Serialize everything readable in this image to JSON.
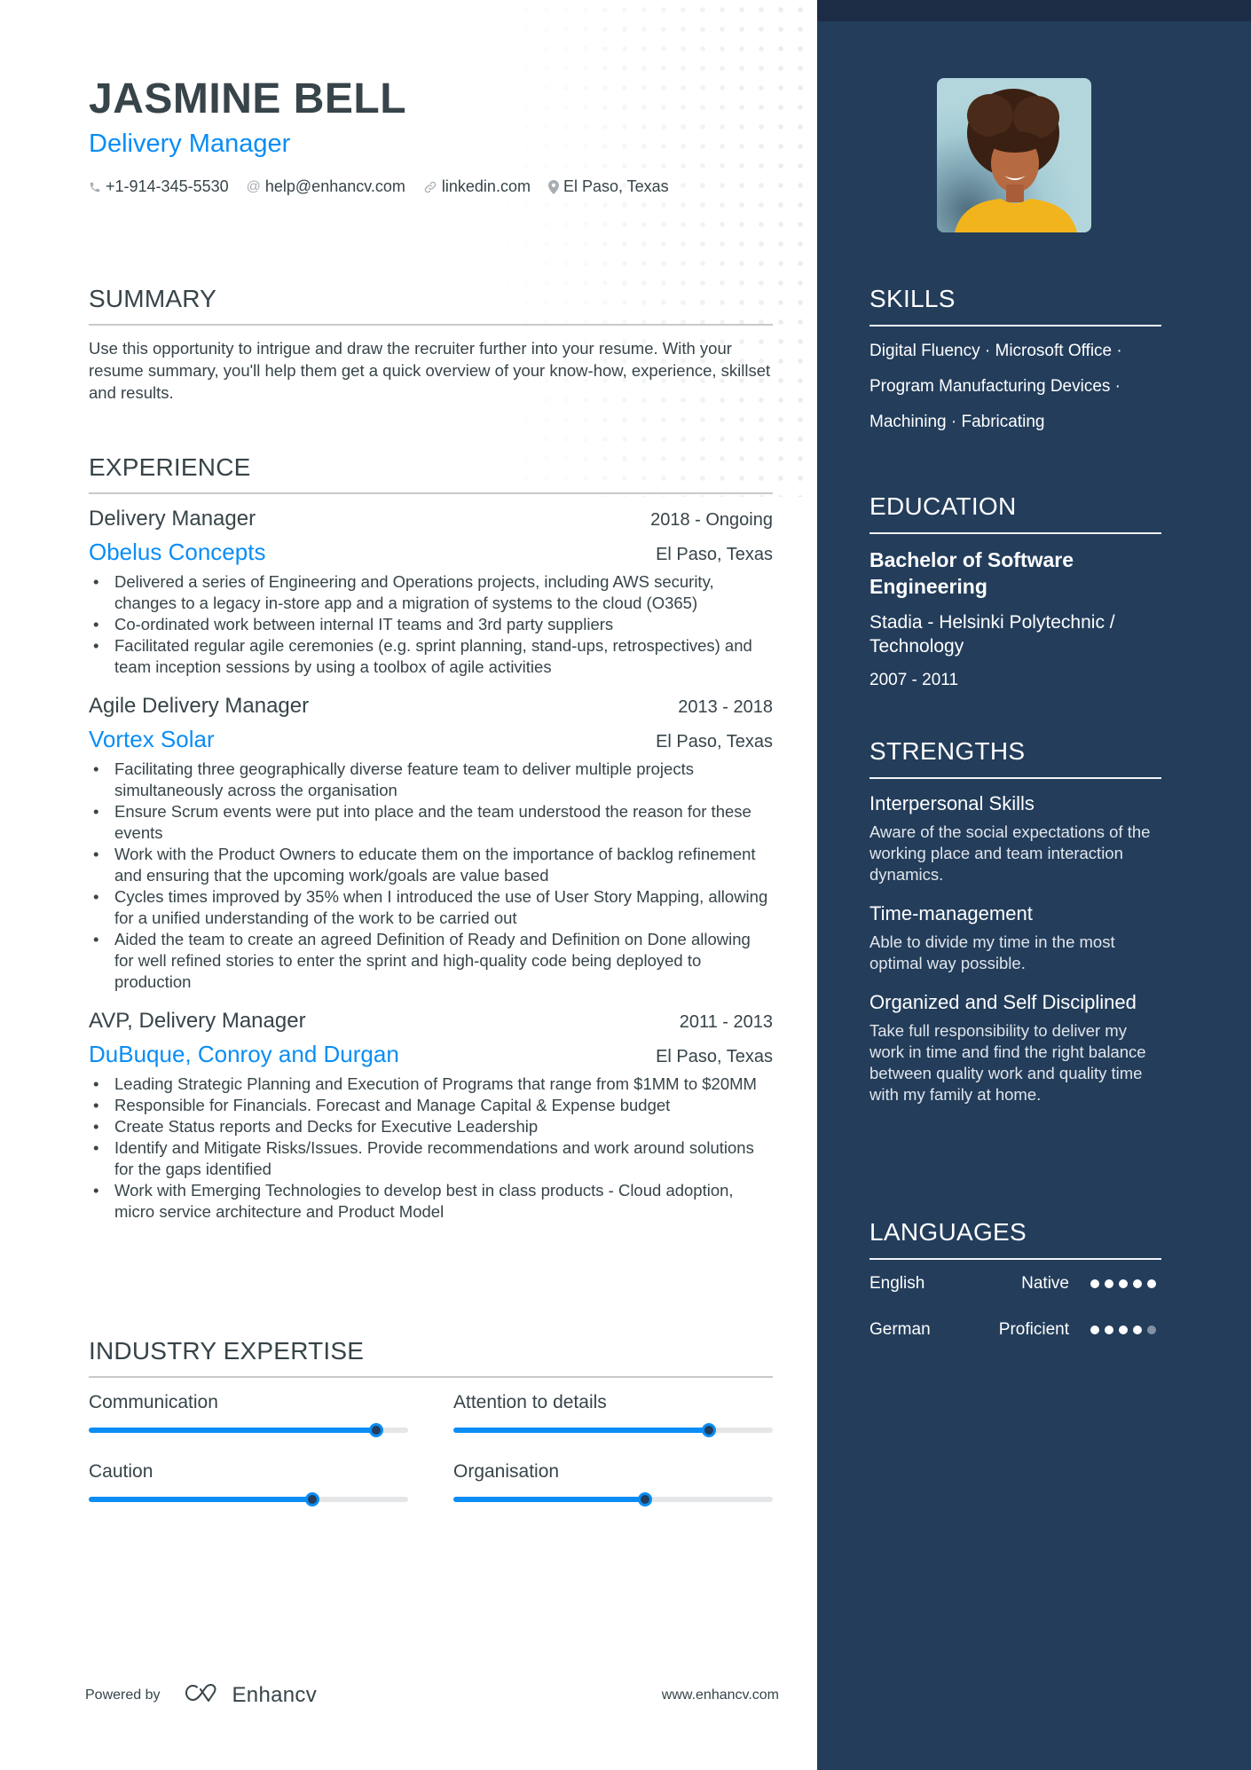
{
  "colors": {
    "accent": "#0a8df5",
    "text": "#374449",
    "sidebar_bg": "#233d5b",
    "sidebar_top": "#1b2c44",
    "slider_track": "#e5e6e7"
  },
  "header": {
    "name": "JASMINE BELL",
    "title": "Delivery Manager",
    "contacts": [
      {
        "icon": "phone-icon",
        "text": "+1-914-345-5530"
      },
      {
        "icon": "at-icon",
        "text": "help@enhancv.com"
      },
      {
        "icon": "link-icon",
        "text": "linkedin.com"
      },
      {
        "icon": "location-pin-icon",
        "text": "El Paso, Texas"
      }
    ]
  },
  "summary": {
    "title": "SUMMARY",
    "text": "Use this opportunity to intrigue and draw the recruiter further into your resume. With your resume summary, you'll help them get a quick overview of your know-how, experience, skillset and results."
  },
  "experience": {
    "title": "EXPERIENCE",
    "jobs": [
      {
        "role": "Delivery Manager",
        "dates": "2018 - Ongoing",
        "company": "Obelus Concepts",
        "location": "El Paso, Texas",
        "bullets": [
          "Delivered a series of Engineering and Operations projects, including AWS security, changes to a legacy in-store app and a migration of systems to the cloud (O365)",
          "Co-ordinated work between internal IT teams and 3rd party suppliers",
          "Facilitated regular agile ceremonies (e.g. sprint planning, stand-ups, retrospectives) and team inception sessions by using a toolbox of agile activities"
        ]
      },
      {
        "role": "Agile Delivery Manager",
        "dates": "2013 - 2018",
        "company": "Vortex Solar",
        "location": "El Paso, Texas",
        "bullets": [
          "Facilitating three geographically diverse feature team to deliver multiple projects simultaneously across the organisation",
          "Ensure Scrum events were put into place and the team understood the reason for these events",
          "Work with the Product Owners to educate them on the importance of backlog refinement and ensuring that the upcoming work/goals are value based",
          "Cycles times improved by 35% when I introduced the use of User Story Mapping, allowing for a unified understanding of the work to be carried out",
          "Aided the team to create an agreed Definition of Ready and Definition on Done allowing for well refined stories to enter the sprint and high-quality code being deployed to production"
        ]
      },
      {
        "role": "AVP, Delivery Manager",
        "dates": "2011 - 2013",
        "company": "DuBuque, Conroy and Durgan",
        "location": "El Paso, Texas",
        "bullets": [
          "Leading Strategic Planning and Execution of Programs that range from $1MM to $20MM",
          "Responsible for Financials. Forecast and Manage Capital & Expense budget",
          "Create Status reports and Decks for Executive Leadership",
          "Identify and Mitigate Risks/Issues. Provide recommendations and work around solutions for the gaps identified",
          "Work with Emerging Technologies to develop best in class products - Cloud adoption, micro service architecture and Product Model"
        ]
      }
    ]
  },
  "expertise": {
    "title": "INDUSTRY EXPERTISE",
    "items": [
      {
        "label": "Communication",
        "level": 0.9
      },
      {
        "label": "Attention to details",
        "level": 0.8
      },
      {
        "label": "Caution",
        "level": 0.7
      },
      {
        "label": "Organisation",
        "level": 0.6
      }
    ]
  },
  "footer": {
    "powered_by": "Powered by",
    "brand": "Enhancv",
    "url": "www.enhancv.com"
  },
  "sidebar": {
    "photo_alt": "Profile photo of Jasmine Bell",
    "skills": {
      "title": "SKILLS",
      "items": [
        "Digital Fluency",
        "Microsoft Office",
        "Program Manufacturing Devices",
        "Machining",
        "Fabricating"
      ],
      "lines": [
        "Digital Fluency · Microsoft Office ·",
        "Program Manufacturing Devices ·",
        "Machining · Fabricating"
      ]
    },
    "education": {
      "title": "EDUCATION",
      "degree": "Bachelor of Software Engineering",
      "school": "Stadia - Helsinki Polytechnic / Technology",
      "dates": "2007 - 2011"
    },
    "strengths": {
      "title": "STRENGTHS",
      "items": [
        {
          "title": "Interpersonal Skills",
          "desc": "Aware of the social expectations of the working place and team interaction dynamics."
        },
        {
          "title": "Time-management",
          "desc": "Able to divide my time in the most optimal way possible."
        },
        {
          "title": "Organized and Self Disciplined",
          "desc": "Take full responsibility to deliver my work in time and find the right balance between quality work and quality time with my family at home."
        }
      ]
    },
    "languages": {
      "title": "LANGUAGES",
      "items": [
        {
          "name": "English",
          "level": "Native",
          "dots": 5,
          "max": 5
        },
        {
          "name": "German",
          "level": "Proficient",
          "dots": 4,
          "max": 5
        }
      ]
    }
  }
}
